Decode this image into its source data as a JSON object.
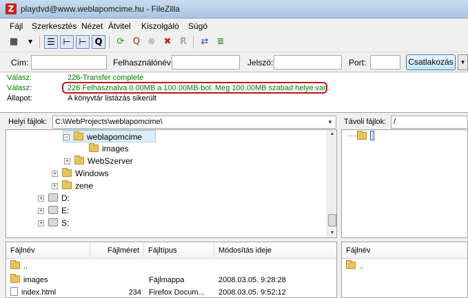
{
  "window": {
    "title": "playdvd@www.weblapomcime.hu - FileZilla",
    "app_icon": "filezilla-icon"
  },
  "menu": [
    "Fájl",
    "Szerkesztés",
    "Nézet",
    "Átvitel",
    "Kiszolgáló",
    "Súgó"
  ],
  "toolbar": {
    "icons": [
      "site-manager-icon",
      "dropdown-arrow-icon",
      "toggle-log-icon",
      "toggle-local-tree-icon",
      "toggle-remote-tree-icon",
      "toggle-queue-icon",
      "refresh-icon",
      "process-queue-icon",
      "cancel-icon",
      "disconnect-icon",
      "reconnect-icon",
      "compare-icon",
      "filter-icon"
    ]
  },
  "quickconnect": {
    "host_label": "Cím:",
    "user_label": "Felhasználónév:",
    "pass_label": "Jelszó:",
    "port_label": "Port:",
    "host_value": "",
    "user_value": "",
    "pass_value": "",
    "port_value": "",
    "connect_button": "Csatlakozás"
  },
  "log": [
    {
      "key": "Válasz:",
      "text": "226-Transfer complete",
      "color": "#008000"
    },
    {
      "key": "Válasz:",
      "text": "226 Felhasznalva 0.00MB a 100.00MB-bol. Meg 100.00MB szabad helye van.",
      "color": "#008000"
    },
    {
      "key": "Állapot:",
      "text": "A könyvtár listázás sikerült",
      "color": "#000000"
    }
  ],
  "local": {
    "label": "Helyi fájlok:",
    "path": "C:\\WebProjects\\weblapomcime\\",
    "tree": [
      {
        "label": "weblapomcime",
        "expander": "−",
        "selected": true
      },
      {
        "label": "images",
        "expander": "",
        "selected": false
      },
      {
        "label": "WebSzerver",
        "expander": "+",
        "selected": false
      },
      {
        "label": "Windows",
        "expander": "+",
        "selected": false
      },
      {
        "label": "zene",
        "expander": "+",
        "selected": false
      },
      {
        "label": "D:",
        "expander": "+",
        "selected": false
      },
      {
        "label": "E:",
        "expander": "+",
        "selected": false
      },
      {
        "label": "S:",
        "expander": "+",
        "selected": false
      }
    ],
    "columns": [
      "Fájlnév",
      "Fájlméret",
      "Fájltípus",
      "Módosítás ideje"
    ],
    "files": [
      {
        "name": "..",
        "size": "",
        "type": "",
        "modified": "",
        "icon": "folder-icon"
      },
      {
        "name": "images",
        "size": "",
        "type": "Fájlmappa",
        "modified": "2008.03.05. 9:28:28",
        "icon": "folder-icon"
      },
      {
        "name": "index.html",
        "size": "234",
        "type": "Firefox Docum...",
        "modified": "2008.03.05. 9:52:12",
        "icon": "html-file-icon"
      }
    ]
  },
  "remote": {
    "label": "Távoli fájlok:",
    "path": "/",
    "tree_root": "",
    "columns": [
      "Fájlnév"
    ],
    "files": [
      {
        "name": "..",
        "icon": "folder-icon"
      }
    ]
  }
}
